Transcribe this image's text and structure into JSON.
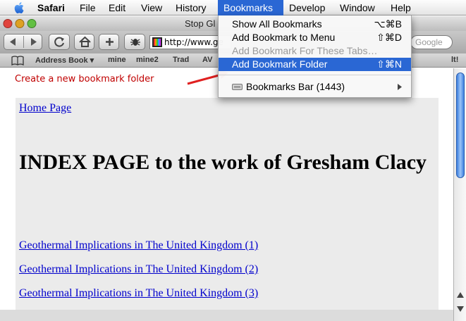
{
  "menubar": {
    "items": [
      "Safari",
      "File",
      "Edit",
      "View",
      "History",
      "Bookmarks",
      "Develop",
      "Window",
      "Help"
    ],
    "active": "Bookmarks"
  },
  "window": {
    "title": "Stop Gl"
  },
  "toolbar": {
    "url": "http://www.ge",
    "search_placeholder": "Google"
  },
  "bookmarks_bar": {
    "items": [
      "Address Book ▾",
      "mine",
      "mine2",
      "Trad",
      "AV"
    ],
    "trailing_fragment": "lt!"
  },
  "bookmarks_menu": {
    "items": [
      {
        "label": "Show All Bookmarks",
        "shortcut": "⌥⌘B",
        "enabled": true
      },
      {
        "label": "Add Bookmark to Menu",
        "shortcut": "⇧⌘D",
        "enabled": true
      },
      {
        "label": "Add Bookmark For These Tabs…",
        "shortcut": "",
        "enabled": false
      },
      {
        "label": "Add Bookmark Folder",
        "shortcut": "⇧⌘N",
        "enabled": true,
        "highlighted": true
      }
    ],
    "submenu": {
      "label": "Bookmarks Bar (1443)",
      "icon": "bookmarks-bar-icon",
      "has_arrow": true
    }
  },
  "annotation": {
    "text": "Create a new bookmark folder",
    "color": "#c00000"
  },
  "page": {
    "home_link": "Home Page",
    "heading": "INDEX PAGE to the work of Gresham Clacy",
    "links": [
      "Geothermal Implications in The United Kingdom (1)",
      "Geothermal Implications in The United Kingdom (2)",
      "Geothermal Implications in The United Kingdom (3)"
    ]
  },
  "colors": {
    "selection": "#2a67d4",
    "link": "#0000cc",
    "card_background": "#ebebeb"
  }
}
